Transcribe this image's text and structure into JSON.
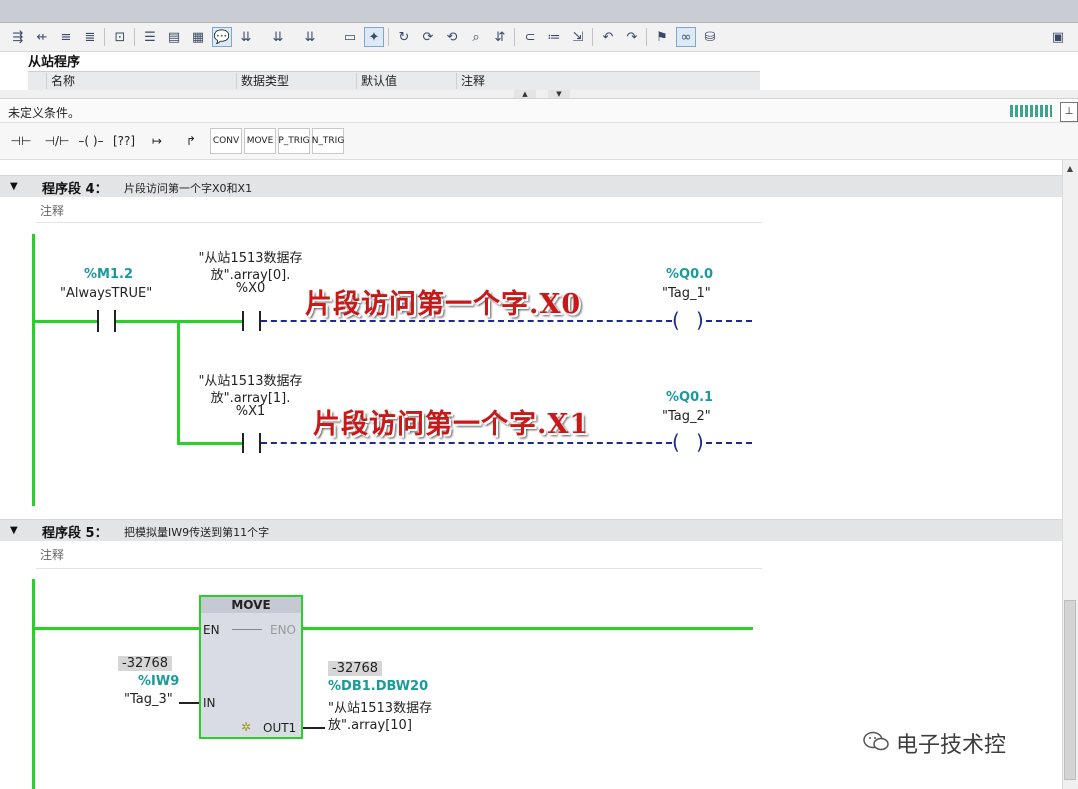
{
  "interface": {
    "title": "从站程序",
    "columns": [
      "名称",
      "数据类型",
      "默认值",
      "注释"
    ]
  },
  "status": {
    "undefined_condition": "未定义条件。"
  },
  "instruction_bar": {
    "items": [
      {
        "label": "⊣⊢",
        "name": "no-contact"
      },
      {
        "label": "⊣/⊢",
        "name": "nc-contact"
      },
      {
        "label": "–( )–",
        "name": "coil"
      },
      {
        "label": "[??]",
        "name": "empty-box"
      },
      {
        "label": "↦",
        "name": "open-branch"
      },
      {
        "label": "↱",
        "name": "close-branch"
      },
      {
        "label": "CONV",
        "name": "conv"
      },
      {
        "label": "MOVE",
        "name": "move"
      },
      {
        "label": "P_TRIG",
        "name": "p-trig"
      },
      {
        "label": "N_TRIG",
        "name": "n-trig"
      }
    ]
  },
  "network4": {
    "number": "程序段 4：",
    "title": "片段访问第一个字X0和X1",
    "comment": "注释",
    "contact": {
      "address": "%M1.2",
      "tag": "\"AlwaysTRUE\""
    },
    "rung1": {
      "operand_line1": "\"从站1513数据存",
      "operand_line2": "放\".array[0].",
      "operand_line3": "%X0",
      "annotation": "片段访问第一个字.X0",
      "coil_address": "%Q0.0",
      "coil_tag": "\"Tag_1\""
    },
    "rung2": {
      "operand_line1": "\"从站1513数据存",
      "operand_line2": "放\".array[1].",
      "operand_line3": "%X1",
      "annotation": "片段访问第一个字.X1",
      "coil_address": "%Q0.1",
      "coil_tag": "\"Tag_2\""
    }
  },
  "network5": {
    "number": "程序段 5：",
    "title": "把模拟量IW9传送到第11个字",
    "comment": "注释",
    "move": {
      "title": "MOVE",
      "en": "EN",
      "eno": "ENO",
      "in": "IN",
      "out": "OUT1",
      "in_value": "-32768",
      "in_address": "%IW9",
      "in_tag": "\"Tag_3\"",
      "out_value": "-32768",
      "out_address": "%DB1.DBW20",
      "out_tag_line1": "\"从站1513数据存",
      "out_tag_line2": "放\".array[10]"
    }
  },
  "watermark": "电子技术控",
  "colors": {
    "power_flow": "#2ad02a",
    "address": "#1a9a9a",
    "annotation": "#c81818",
    "dashed_wire": "#1a2b8a"
  }
}
